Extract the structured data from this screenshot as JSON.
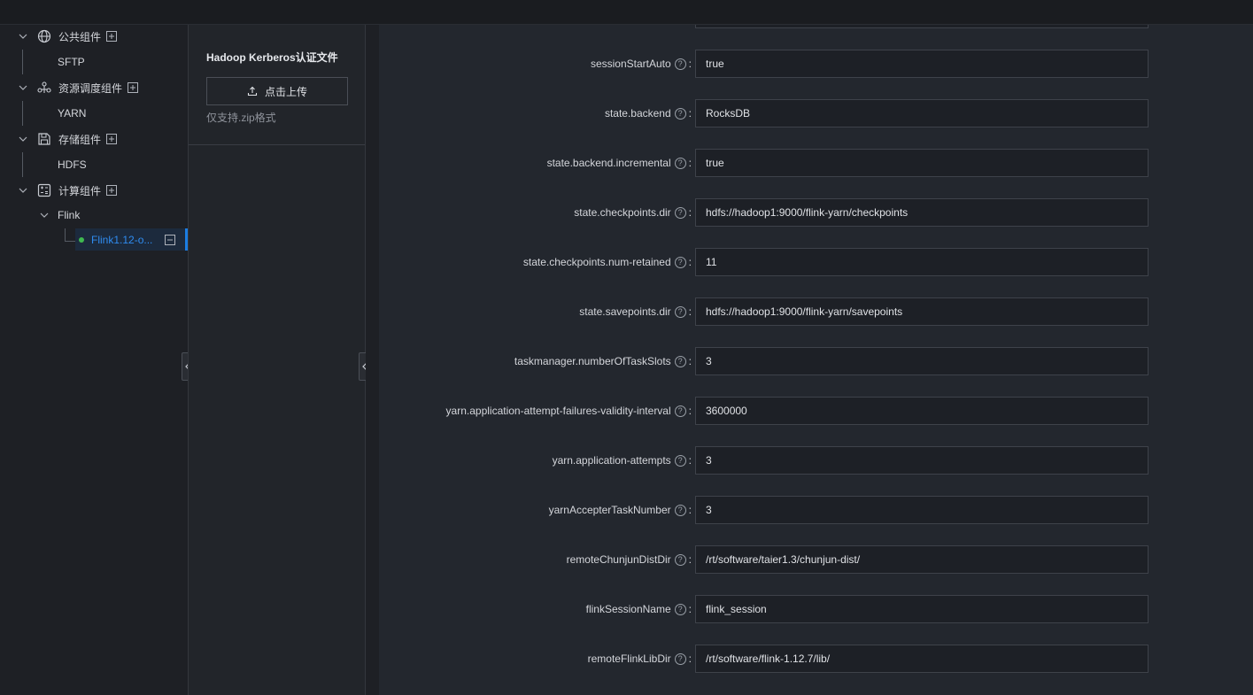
{
  "tree": {
    "groups": [
      {
        "label": "公共组件",
        "icon": "globe-icon",
        "children": [
          "SFTP"
        ]
      },
      {
        "label": "资源调度组件",
        "icon": "cluster-icon",
        "children": [
          "YARN"
        ]
      },
      {
        "label": "存储组件",
        "icon": "save-icon",
        "children": [
          "HDFS"
        ]
      },
      {
        "label": "计算组件",
        "icon": "calculator-icon",
        "children": [
          "Flink"
        ]
      }
    ],
    "selected": {
      "label": "Flink1.12-o...",
      "status_color": "#3fb950"
    }
  },
  "upload": {
    "title": "Hadoop Kerberos认证文件",
    "button_label": "点击上传",
    "hint": "仅支持.zip格式"
  },
  "form": {
    "fields": [
      {
        "label": "sessionStartAuto",
        "value": "true"
      },
      {
        "label": "state.backend",
        "value": "RocksDB"
      },
      {
        "label": "state.backend.incremental",
        "value": "true"
      },
      {
        "label": "state.checkpoints.dir",
        "value": "hdfs://hadoop1:9000/flink-yarn/checkpoints"
      },
      {
        "label": "state.checkpoints.num-retained",
        "value": "11"
      },
      {
        "label": "state.savepoints.dir",
        "value": "hdfs://hadoop1:9000/flink-yarn/savepoints"
      },
      {
        "label": "taskmanager.numberOfTaskSlots",
        "value": "3"
      },
      {
        "label": "yarn.application-attempt-failures-validity-interval",
        "value": "3600000"
      },
      {
        "label": "yarn.application-attempts",
        "value": "3"
      },
      {
        "label": "yarnAccepterTaskNumber",
        "value": "3"
      },
      {
        "label": "remoteChunjunDistDir",
        "value": "/rt/software/taier1.3/chunjun-dist/"
      },
      {
        "label": "flinkSessionName",
        "value": "flink_session"
      },
      {
        "label": "remoteFlinkLibDir",
        "value": "/rt/software/flink-1.12.7/lib/"
      }
    ],
    "help_glyph": "?",
    "colon": ":"
  },
  "colors": {
    "accent": "#1b7de3",
    "selected_text": "#2f8cf0"
  }
}
